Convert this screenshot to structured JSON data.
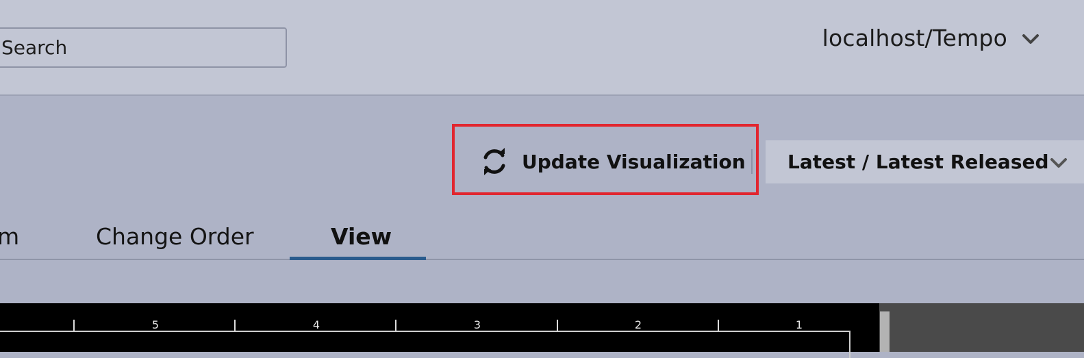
{
  "header": {
    "search_text": "Search",
    "server_label": "localhost/Tempo"
  },
  "toolbar": {
    "update_label": "Update Visualization",
    "release_label": "Latest / Latest Released"
  },
  "tabs": [
    {
      "label": "m"
    },
    {
      "label": "Change Order"
    },
    {
      "label": "View",
      "active": true
    }
  ],
  "ruler": {
    "labels": [
      "5",
      "4",
      "3",
      "2",
      "1"
    ]
  },
  "colors": {
    "highlight": "#e1262f",
    "active_tab_underline": "#2a5b8d"
  },
  "icons": {
    "refresh": "refresh-icon",
    "chevron": "chevron-down-icon"
  }
}
